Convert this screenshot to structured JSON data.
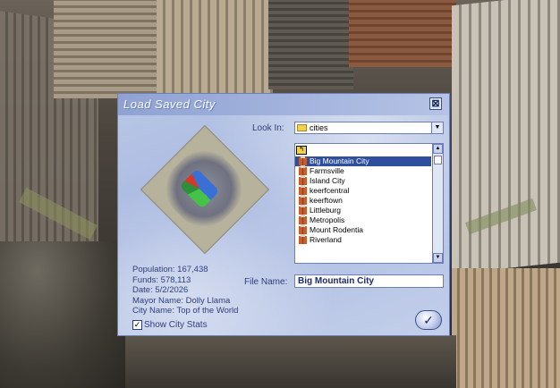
{
  "dialog": {
    "title": "Load Saved City",
    "close_glyph": "⊠",
    "look_in_label": "Look In:",
    "look_in_value": "cities",
    "file_name_label": "File Name:",
    "file_name_value": "Big Mountain City",
    "ok_glyph": "✓",
    "up_glyph": "↰"
  },
  "files": [
    "Big Mountain City",
    "Farmsville",
    "Island City",
    "keerfcentral",
    "keerftown",
    "Littleburg",
    "Metropolis",
    "Mount Rodentia",
    "Riverland"
  ],
  "selected_file_index": 0,
  "stats": {
    "population": "Population: 167,438",
    "funds": "Funds: 578,113",
    "date": "Date: 5/2/2026",
    "mayor": "Mayor Name: Dolly Llama",
    "city_name": "City Name: Top of the World"
  },
  "show_city_stats": {
    "label": "Show City Stats",
    "checked": true,
    "check_glyph": "✓"
  },
  "colors": {
    "dialog_bg": "#b9c7e6",
    "selection": "#2f4f9e",
    "text": "#2f3f7a"
  }
}
